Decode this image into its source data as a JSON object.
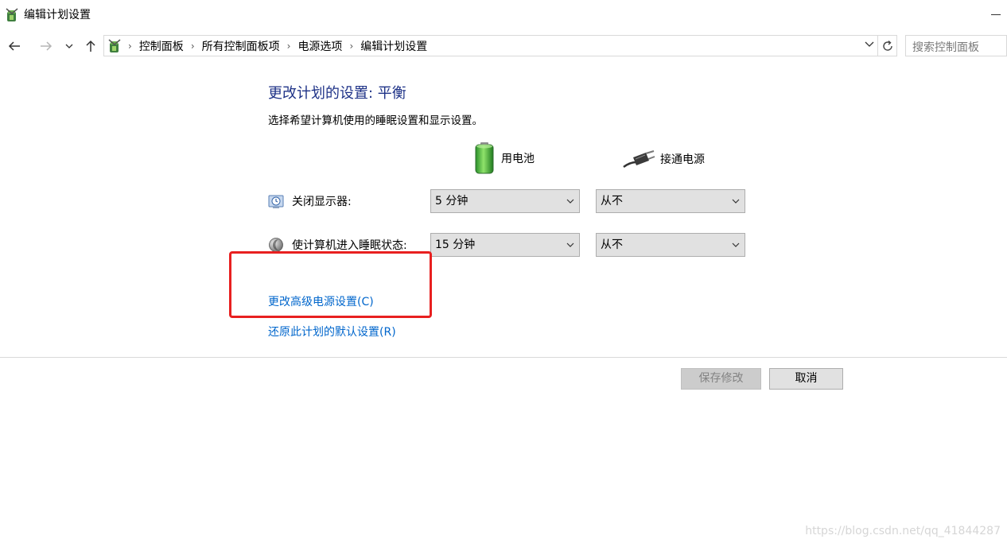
{
  "window": {
    "title": "编辑计划设置",
    "search_placeholder": "搜索控制面板"
  },
  "breadcrumb": [
    "控制面板",
    "所有控制面板项",
    "电源选项",
    "编辑计划设置"
  ],
  "main": {
    "heading": "更改计划的设置: 平衡",
    "subheading": "选择希望计算机使用的睡眠设置和显示设置。",
    "columns": {
      "battery": "用电池",
      "plugged_in": "接通电源"
    },
    "rows": [
      {
        "label": "关闭显示器:",
        "battery_value": "5 分钟",
        "plugged_value": "从不"
      },
      {
        "label": "使计算机进入睡眠状态:",
        "battery_value": "15 分钟",
        "plugged_value": "从不"
      }
    ],
    "links": {
      "advanced": "更改高级电源设置(C)",
      "restore": "还原此计划的默认设置(R)"
    }
  },
  "buttons": {
    "save": "保存修改",
    "cancel": "取消"
  },
  "watermark": "https://blog.csdn.net/qq_41844287",
  "colors": {
    "heading": "#1e3287",
    "link": "#0066cc",
    "highlight": "#e82020"
  }
}
